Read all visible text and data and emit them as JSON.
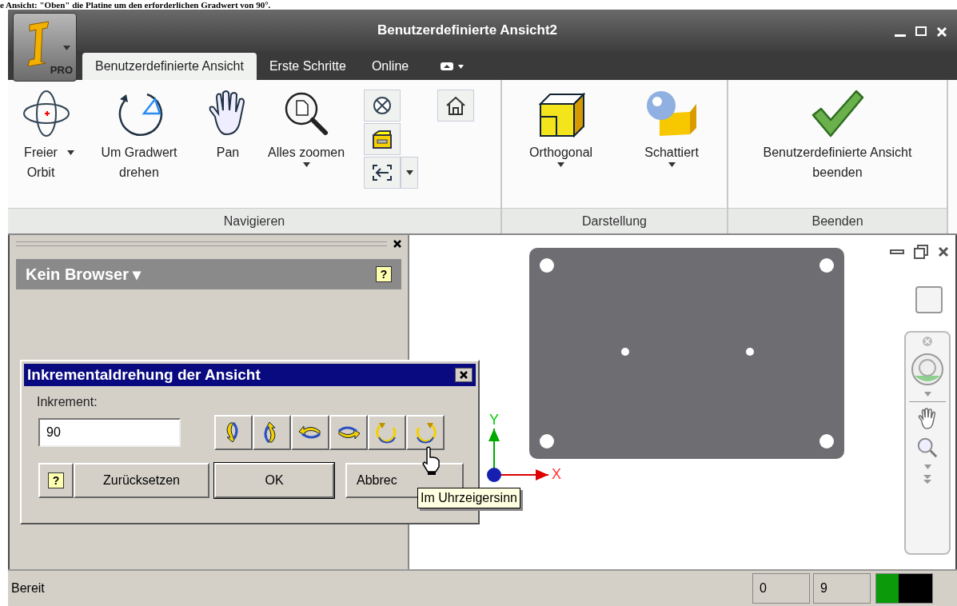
{
  "caption": "e Ansicht: \"Oben\" die Platine um den erforderlichen Gradwert von 90°.",
  "window": {
    "title": "Benutzerdefinierte Ansicht2",
    "app_badge": "PRO"
  },
  "tabs": [
    {
      "label": "Benutzerdefinierte Ansicht",
      "selected": true
    },
    {
      "label": "Erste Schritte",
      "selected": false
    },
    {
      "label": "Online",
      "selected": false
    }
  ],
  "ribbon": [
    {
      "title": "Navigieren",
      "buttons": [
        {
          "kind": "orbit",
          "label": "Freier Orbit",
          "dropdown": true
        },
        {
          "kind": "rotate",
          "label": "Um Gradwert drehen",
          "dropdown": false
        },
        {
          "kind": "pan",
          "label": "Pan",
          "dropdown": false
        },
        {
          "kind": "zoom",
          "label": "Alles zoomen",
          "dropdown": true
        }
      ]
    },
    {
      "title": "Darstellung",
      "buttons": [
        {
          "kind": "cube",
          "label": "Orthogonal",
          "dropdown": true
        },
        {
          "kind": "shaded",
          "label": "Schattiert",
          "dropdown": true
        }
      ]
    },
    {
      "title": "Beenden",
      "buttons": [
        {
          "kind": "check",
          "label": "Benutzerdefinierte Ansicht beenden",
          "dropdown": false
        }
      ]
    }
  ],
  "browser": {
    "title": "Kein Browser ▾",
    "help": "?"
  },
  "dialog": {
    "title": "Inkrementaldrehung der Ansicht",
    "label": "Inkrement:",
    "value": "90",
    "buttons": [
      "Zurücksetzen",
      "OK",
      "Abbrec"
    ],
    "help": "?"
  },
  "tooltip": "Im Uhrzeigersinn",
  "axes": {
    "x": "X",
    "y": "Y"
  },
  "status_bar": {
    "text": "Bereit",
    "fields": [
      "0",
      "9"
    ]
  }
}
